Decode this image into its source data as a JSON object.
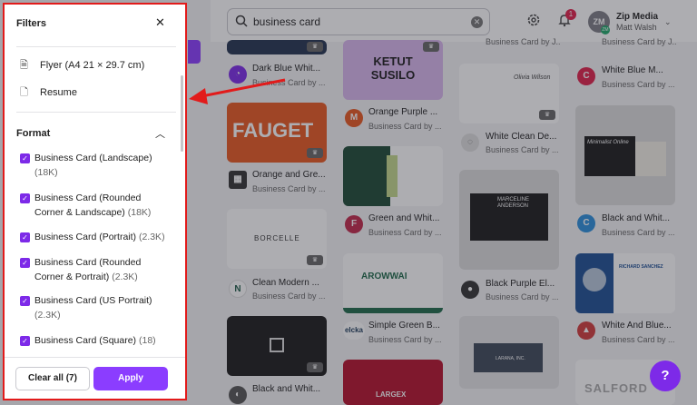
{
  "search": {
    "query": "business card"
  },
  "account": {
    "initials": "ZM",
    "avatar_badge": "ZM",
    "org": "Zip Media",
    "user": "Matt Walsh"
  },
  "notifications": {
    "count": "1"
  },
  "filters_panel": {
    "title": "Filters",
    "quick_items": [
      {
        "label": "Flyer (A4 21 × 29.7 cm)",
        "icon": "file-icon"
      },
      {
        "label": "Resume",
        "icon": "document-icon"
      }
    ],
    "format_heading": "Format",
    "options": [
      {
        "label": "Business Card (Landscape)",
        "count": "(18K)",
        "checked": true
      },
      {
        "label": "Business Card (Rounded Corner & Landscape)",
        "count": "(18K)",
        "checked": true
      },
      {
        "label": "Business Card (Portrait)",
        "count": "(2.3K)",
        "checked": true
      },
      {
        "label": "Business Card (Rounded Corner & Portrait)",
        "count": "(2.3K)",
        "checked": true
      },
      {
        "label": "Business Card (US Portrait)",
        "count": "(2.3K)",
        "checked": true
      },
      {
        "label": "Business Card (Square)",
        "count": "(18)",
        "checked": true
      }
    ],
    "clear_label": "Clear all (7)",
    "apply_label": "Apply"
  },
  "templates": [
    {
      "title": "Dark Blue Whit...",
      "sub": "Business Card by ..."
    },
    {
      "title": "Orange and Gre...",
      "sub": "Business Card by ..."
    },
    {
      "title": "Clean Modern ...",
      "sub": "Business Card by ..."
    },
    {
      "title": "Black and Whit...",
      "sub": ""
    },
    {
      "title": "Orange Purple ...",
      "sub": "Business Card by ..."
    },
    {
      "title": "Green and Whit...",
      "sub": "Business Card by ..."
    },
    {
      "title": "Simple Green B...",
      "sub": "Business Card by ..."
    },
    {
      "title": "White Clean De...",
      "sub": "Business Card by ..."
    },
    {
      "title": "Black Purple El...",
      "sub": "Business Card by ..."
    },
    {
      "title": "White Blue M...",
      "sub": "Business Card by ..."
    },
    {
      "title": "Black and Whit...",
      "sub": "Business Card by ..."
    },
    {
      "title": "White And Blue...",
      "sub": "Business Card by ..."
    }
  ],
  "top_subs": [
    "Business Card by J...",
    "Business Card by J..."
  ],
  "card_texts": {
    "ketut": "KETUT SUSILO",
    "fauget": "FAUGET",
    "borcelle": "BORCELLE",
    "marceline": "MARCELINE ANDERSON",
    "arowwai": "AROWWAI",
    "larana": "LARANA, INC.",
    "salford": "SALFORD",
    "largex": "LARGEX",
    "richard": "RICHARD SANCHEZ",
    "olivia": "Olivia Wilson",
    "minimalist": "Minimalist Online"
  },
  "avatar_letters": {
    "orange": "M",
    "green": "F",
    "red": "C",
    "teal": "C",
    "elcka": "elcka"
  },
  "colors": {
    "accent": "#8b3dff",
    "highlight": "#e21b1b"
  }
}
